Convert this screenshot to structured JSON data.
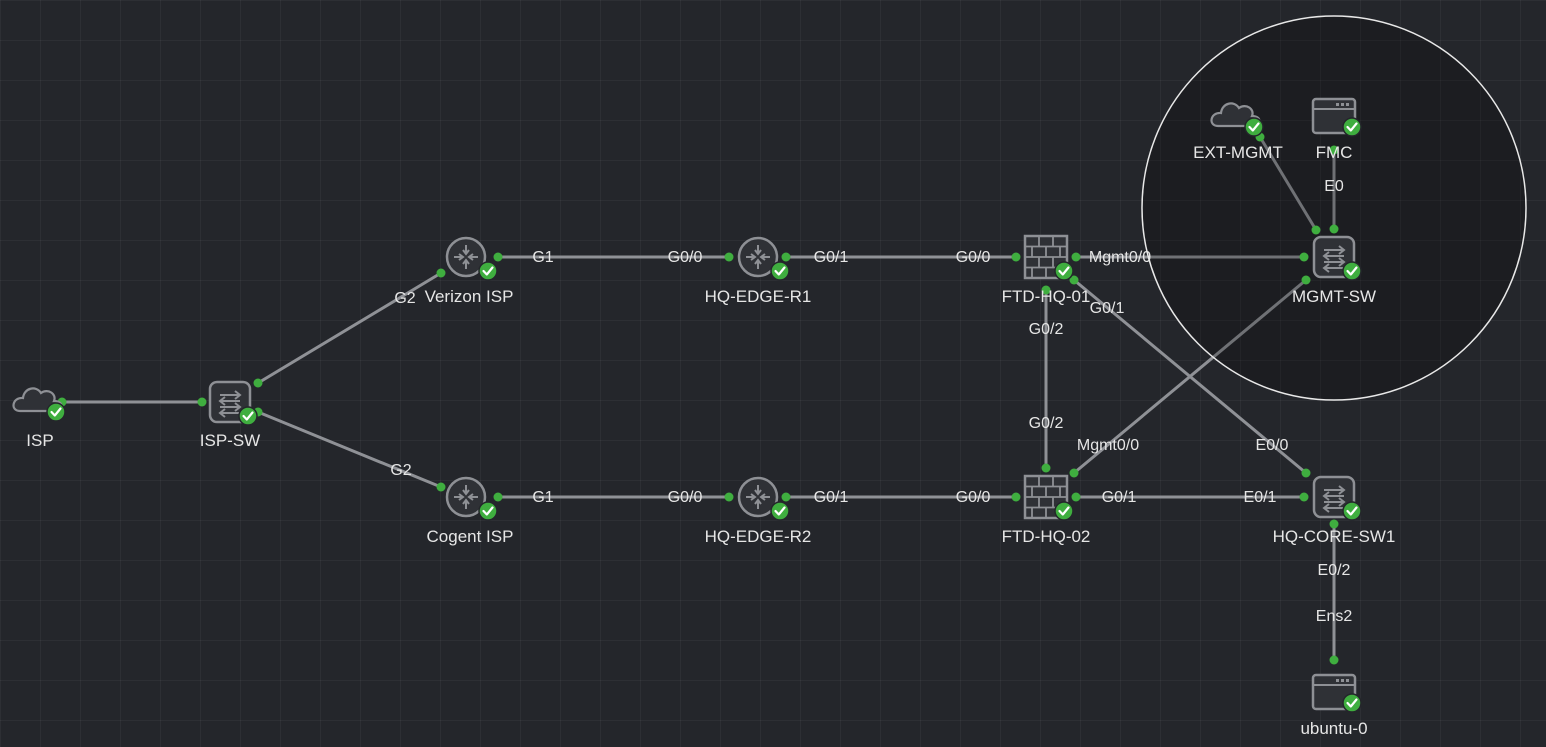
{
  "topology": {
    "nodes": [
      {
        "id": "isp",
        "label": "ISP",
        "type": "cloud",
        "status": "running"
      },
      {
        "id": "isp-sw",
        "label": "ISP-SW",
        "type": "switch",
        "status": "running"
      },
      {
        "id": "verizon",
        "label": "Verizon ISP",
        "type": "router",
        "status": "running"
      },
      {
        "id": "cogent",
        "label": "Cogent ISP",
        "type": "router",
        "status": "running"
      },
      {
        "id": "hq-edge-r1",
        "label": "HQ-EDGE-R1",
        "type": "router",
        "status": "running"
      },
      {
        "id": "hq-edge-r2",
        "label": "HQ-EDGE-R2",
        "type": "router",
        "status": "running"
      },
      {
        "id": "ftd-hq-01",
        "label": "FTD-HQ-01",
        "type": "firewall",
        "status": "running"
      },
      {
        "id": "ftd-hq-02",
        "label": "FTD-HQ-02",
        "type": "firewall",
        "status": "running"
      },
      {
        "id": "mgmt-sw",
        "label": "MGMT-SW",
        "type": "switch",
        "status": "running"
      },
      {
        "id": "ext-mgmt",
        "label": "EXT-MGMT",
        "type": "cloud",
        "status": "running"
      },
      {
        "id": "fmc",
        "label": "FMC",
        "type": "server",
        "status": "running"
      },
      {
        "id": "hq-core-sw1",
        "label": "HQ-CORE-SW1",
        "type": "switch",
        "status": "running"
      },
      {
        "id": "ubuntu-0",
        "label": "ubuntu-0",
        "type": "server",
        "status": "running"
      }
    ],
    "links": [
      {
        "from": "isp",
        "to": "isp-sw",
        "from_if": "",
        "to_if": ""
      },
      {
        "from": "isp-sw",
        "to": "verizon",
        "from_if": "",
        "to_if": "G2"
      },
      {
        "from": "isp-sw",
        "to": "cogent",
        "from_if": "",
        "to_if": "G2"
      },
      {
        "from": "verizon",
        "to": "hq-edge-r1",
        "from_if": "G1",
        "to_if": "G0/0"
      },
      {
        "from": "cogent",
        "to": "hq-edge-r2",
        "from_if": "G1",
        "to_if": "G0/0"
      },
      {
        "from": "hq-edge-r1",
        "to": "ftd-hq-01",
        "from_if": "G0/1",
        "to_if": "G0/0"
      },
      {
        "from": "hq-edge-r2",
        "to": "ftd-hq-02",
        "from_if": "G0/1",
        "to_if": "G0/0"
      },
      {
        "from": "ftd-hq-01",
        "to": "mgmt-sw",
        "from_if": "Mgmt0/0",
        "to_if": ""
      },
      {
        "from": "ftd-hq-01",
        "to": "ftd-hq-02",
        "from_if": "G0/2",
        "to_if": "G0/2"
      },
      {
        "from": "ftd-hq-01",
        "to": "hq-core-sw1",
        "from_if": "G0/1",
        "to_if": "E0/0"
      },
      {
        "from": "ftd-hq-02",
        "to": "mgmt-sw",
        "from_if": "Mgmt0/0",
        "to_if": ""
      },
      {
        "from": "ftd-hq-02",
        "to": "hq-core-sw1",
        "from_if": "G0/1",
        "to_if": "E0/1"
      },
      {
        "from": "ext-mgmt",
        "to": "mgmt-sw",
        "from_if": "",
        "to_if": ""
      },
      {
        "from": "fmc",
        "to": "mgmt-sw",
        "from_if": "E0",
        "to_if": ""
      },
      {
        "from": "hq-core-sw1",
        "to": "ubuntu-0",
        "from_if": "E0/2",
        "to_if": "Ens2"
      }
    ]
  },
  "colors": {
    "background": "#24262b",
    "link": "#8f9196",
    "status_ok": "#3fae3f",
    "icon_fill": "#2f3136",
    "icon_stroke": "#8e9095",
    "text": "#e6e6e6",
    "selection_ring": "#e8e8e8"
  },
  "icons": {
    "cloud": "cloud-icon",
    "switch": "switch-icon",
    "router": "router-icon",
    "firewall": "firewall-icon",
    "server": "server-icon",
    "status": "check-badge-icon"
  }
}
